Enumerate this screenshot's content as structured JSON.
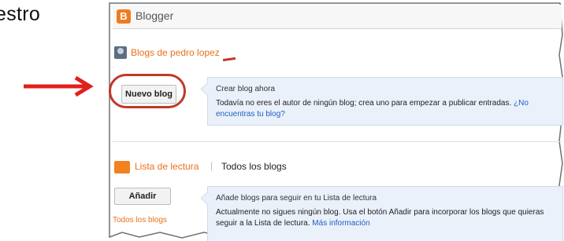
{
  "slide": {
    "partial_text": "estro"
  },
  "header": {
    "logo_letter": "B",
    "title": "Blogger"
  },
  "blogs_section": {
    "title": "Blogs de pedro lopez"
  },
  "new_blog": {
    "button_label": "Nuevo blog",
    "callout_title": "Crear blog ahora",
    "callout_text": "Todavía no eres el autor de ningún blog; crea uno para empezar a publicar entradas.",
    "callout_link": "¿No encuentras tu blog?"
  },
  "reading_section": {
    "tab_active": "Lista de lectura",
    "separator": "|",
    "tab_all": "Todos los blogs"
  },
  "add_blog": {
    "button_label": "Añadir",
    "callout_title": "Añade blogs para seguir en tu Lista de lectura",
    "callout_text": "Actualmente no sigues ningún blog. Usa el botón Añadir para incorporar los blogs que quieras seguir a la Lista de lectura.",
    "callout_link": "Más información"
  },
  "sidebar": {
    "all_blogs_link": "Todos los blogs"
  },
  "colors": {
    "accent_orange": "#e8711a",
    "annotation_red": "#c0392b",
    "callout_bg": "#eaf1fb",
    "link_blue": "#1f5fbf"
  }
}
